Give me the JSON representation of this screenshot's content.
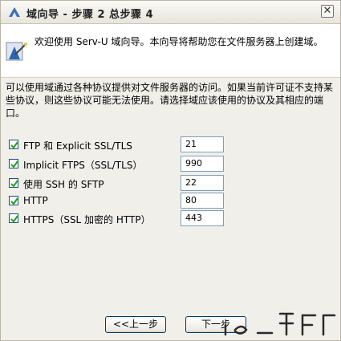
{
  "window": {
    "title": "域向导 - 步骤 2 总步骤 4"
  },
  "banner": {
    "text": "欢迎使用 Serv-U 域向导。本向导将帮助您在文件服务器上创建域。"
  },
  "description": "可以使用域通过各种协议提供对文件服务器的访问。如果当前许可证不支持某些协议，则这些协议可能无法使用。请选择域应该使用的协议及其相应的端口。",
  "protocols": [
    {
      "label": "FTP 和 Explicit SSL/TLS",
      "port": "21",
      "checked": true
    },
    {
      "label": "Implicit FTPS（SSL/TLS）",
      "port": "990",
      "checked": true
    },
    {
      "label": "使用 SSH 的 SFTP",
      "port": "22",
      "checked": true
    },
    {
      "label": "HTTP",
      "port": "80",
      "checked": true
    },
    {
      "label": "HTTPS（SSL 加密的 HTTP）",
      "port": "443",
      "checked": true
    }
  ],
  "buttons": {
    "back": "<<上一步",
    "next": "下一步"
  },
  "colors": {
    "checkmark": "#21a121",
    "checkbox_border": "#1c5180",
    "input_border": "#7f9db9"
  },
  "icons": {
    "title": "wizard-icon",
    "close": "close-icon",
    "banner": "wizard-wand-icon",
    "check": "checkmark-icon"
  }
}
